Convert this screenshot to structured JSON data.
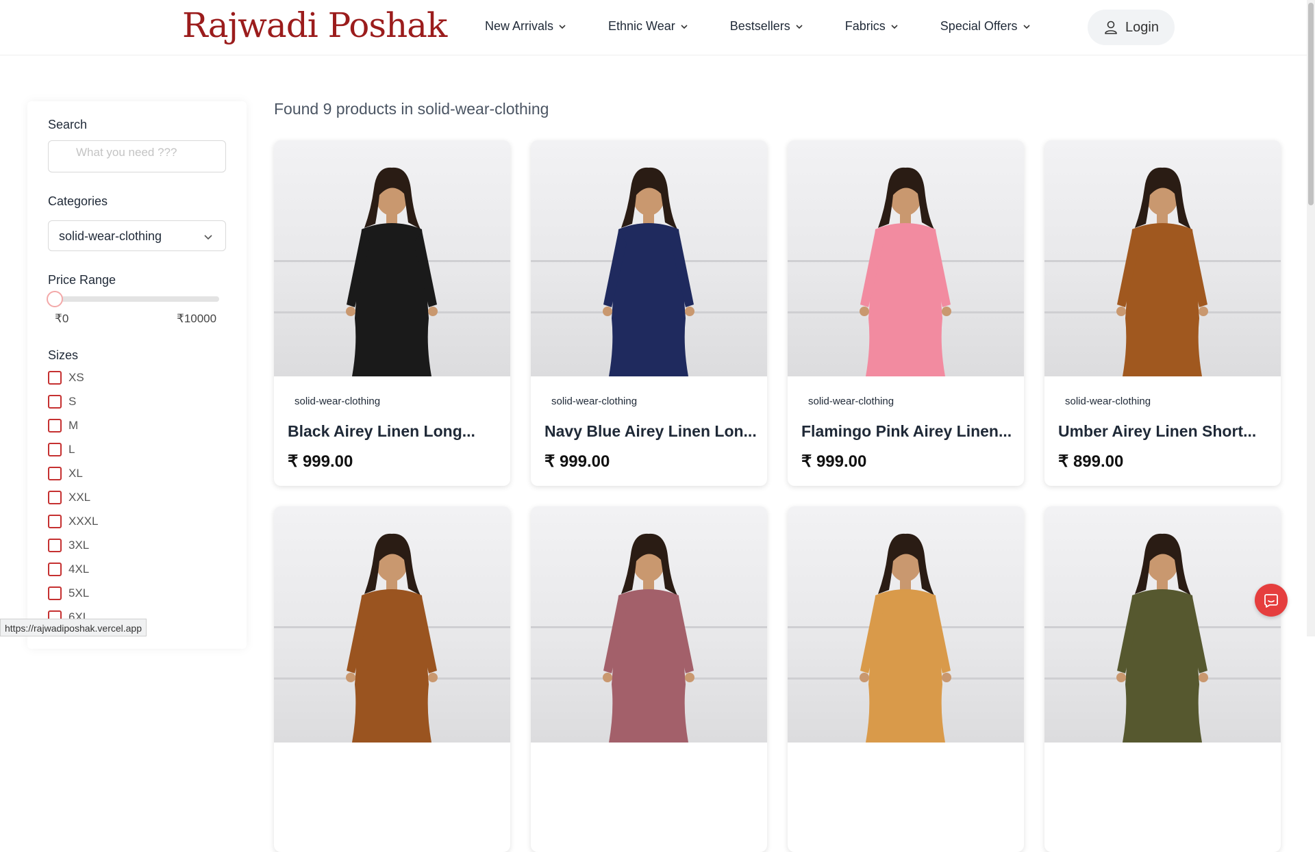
{
  "brand": {
    "logo_text": "Rajwadi Poshak",
    "color": "#9b1c1c"
  },
  "nav": {
    "items": [
      {
        "label": "New Arrivals"
      },
      {
        "label": "Ethnic Wear"
      },
      {
        "label": "Bestsellers"
      },
      {
        "label": "Fabrics"
      },
      {
        "label": "Special Offers"
      }
    ],
    "login_label": "Login"
  },
  "sidebar": {
    "search_label": "Search",
    "search_placeholder": "What you need ???",
    "categories_label": "Categories",
    "category_selected": "solid-wear-clothing",
    "price_label": "Price Range",
    "price_min": "₹0",
    "price_max": "₹10000",
    "price_value": 0,
    "sizes_label": "Sizes",
    "sizes": [
      "XS",
      "S",
      "M",
      "L",
      "XL",
      "XXL",
      "XXXL",
      "3XL",
      "4XL",
      "5XL",
      "6XL"
    ]
  },
  "main": {
    "found_text": "Found 9 products in solid-wear-clothing",
    "products": [
      {
        "tag": "solid-wear-clothing",
        "name": "Black Airey Linen Long...",
        "price": "₹ 999.00",
        "garment_color": "#1a1a1a",
        "icon": "black-kurta-image"
      },
      {
        "tag": "solid-wear-clothing",
        "name": "Navy Blue Airey Linen Lon...",
        "price": "₹ 999.00",
        "garment_color": "#1f2a5e",
        "icon": "navy-kurta-image"
      },
      {
        "tag": "solid-wear-clothing",
        "name": "Flamingo Pink Airey Linen...",
        "price": "₹ 999.00",
        "garment_color": "#f28ba0",
        "icon": "pink-kurta-image"
      },
      {
        "tag": "solid-wear-clothing",
        "name": "Umber Airey Linen Short...",
        "price": "₹ 899.00",
        "garment_color": "#a0581f",
        "icon": "umber-top-image"
      },
      {
        "garment_color": "#9a5420",
        "icon": "rust-pants-image"
      },
      {
        "garment_color": "#a3606a",
        "icon": "rose-kurta-image"
      },
      {
        "garment_color": "#d99a4a",
        "icon": "mustard-kurta-image"
      },
      {
        "garment_color": "#56582f",
        "icon": "olive-kurta-image"
      }
    ]
  },
  "status": {
    "url_tooltip": "https://rajwadiposhak.vercel.app"
  },
  "colors": {
    "accent": "#e53e3e",
    "checkbox_border": "#c53030"
  }
}
